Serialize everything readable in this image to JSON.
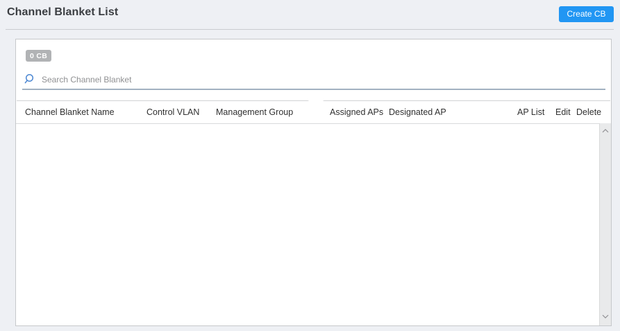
{
  "header": {
    "title": "Channel Blanket List",
    "create_button": "Create CB"
  },
  "panel": {
    "count_badge": "0 CB",
    "search": {
      "placeholder": "Search Channel Blanket",
      "value": ""
    }
  },
  "table": {
    "columns": [
      "Channel Blanket Name",
      "Control VLAN",
      "Management Group",
      "Assigned APs",
      "Designated AP",
      "AP List",
      "Edit",
      "Delete"
    ],
    "rows": []
  },
  "icons": {
    "search": "search-icon",
    "panel_notch": "chevron-down-icon",
    "scroll_up": "chevron-up-icon",
    "scroll_down": "chevron-down-icon"
  },
  "colors": {
    "accent_blue": "#2196f3",
    "badge_gray": "#b1b3b5",
    "search_icon_blue": "#4a86d2",
    "search_underline": "#a2b1c1",
    "page_background": "#eef0f4"
  }
}
